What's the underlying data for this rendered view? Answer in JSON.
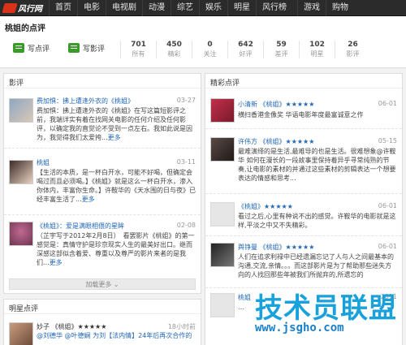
{
  "nav": {
    "logo_text": "风行网",
    "items": [
      "首页",
      "电影",
      "电视剧",
      "动漫",
      "综艺",
      "娱乐",
      "明星",
      "风行榜",
      "游戏",
      "购物"
    ]
  },
  "header": {
    "title": "桃姐的点评",
    "write_comment": "写点评",
    "write_review": "写影评",
    "stats": [
      {
        "num": "701",
        "label": "所有"
      },
      {
        "num": "450",
        "label": "精彩"
      },
      {
        "num": "0",
        "label": "关注"
      },
      {
        "num": "642",
        "label": "好评"
      },
      {
        "num": "59",
        "label": "差评"
      },
      {
        "num": "102",
        "label": "明星"
      },
      {
        "num": "26",
        "label": "影评"
      }
    ]
  },
  "left": {
    "title": "影评",
    "items": [
      {
        "title": "费加惧：拂上遭逢外衣的《桃姐》",
        "date": "03-27",
        "body": "费加惧：拂上遭逢外衣的《桃姐》在写这篇短影评之前，我端详实有着在找网关电影的任何介绍及任何影评，以确定我的直觉论不受到一点左右。我如此说是因为，我觉得我们太爱挎...",
        "more": "更多"
      },
      {
        "title": "桃姐",
        "date": "03-11",
        "body": "【生活的本质，是一杯白开水，可能不好喝，但确定会喝过而且必须喝。】《桃姐》就是这么一杯白开水，渗入你体内，丰富你生命。】许鞍华的《天水围的日与夜》已经丰富生活了...",
        "more": "更多"
      },
      {
        "title": "《桃姐》：爱是满眼相偎的星眸",
        "date": "02-08",
        "body": "（芷宇写于2012年2月8日）　看罢影片《桃姐》的第一感觉是：真情守护是珍京现实人生的最美好出口。继而深感这部似含着爱、尊重以及尊严的影片来者的是我们...",
        "more": "更多"
      }
    ],
    "load_more": "加载更多",
    "star_title": "明星点评",
    "star_item": {
      "title": "妙子 《桃姐》★★★★★",
      "date": "18小时前",
      "body": "@刘德华 @叶德娴 为刘【法内情】24年后再次合作的"
    }
  },
  "right": {
    "title": "精彩点评",
    "items": [
      {
        "title": "小清新 《桃姐》★★★★★",
        "date": "06-01",
        "body": "横扫香港金像奖 华语电影年度最富诚意之作"
      },
      {
        "title": "许伟方 《桃姐》★★★★★",
        "date": "05-15",
        "body": "最难演绎的是生活,最难导的也是生活。很难想象@许鞍华 如何在漫长的一段故事里保持着异乎寻常纯熟的节奏,让电影的素材的并通过这些素材的剪辑表达一个想要表达的情感和思考..."
      },
      {
        "title": "《桃姐》★★★★★",
        "date": "06-01",
        "body": "看过之后,心里有种说不出的感觉。许鞍华的电影就是这样,平淡之中又不失精彩。"
      },
      {
        "title": "舆铮曼 《桃姐》★★★★★",
        "date": "06-01",
        "body": "人们在追求利禄中已经遗漏忘记了人与人之间最基本的沟通,交流,亲情。。。而这部影片是为了帮助那些迷失方向的人找回那些年被我们所抛弃的,所遗忘的"
      },
      {
        "title": "桃姐",
        "date": "2011",
        "body": "…"
      }
    ]
  },
  "watermark": {
    "text": "技术员联盟",
    "url": "www.jsgho.com"
  },
  "colors": {
    "accent": "#d9321b",
    "link": "#2267b5",
    "green": "#3a9b2b"
  }
}
